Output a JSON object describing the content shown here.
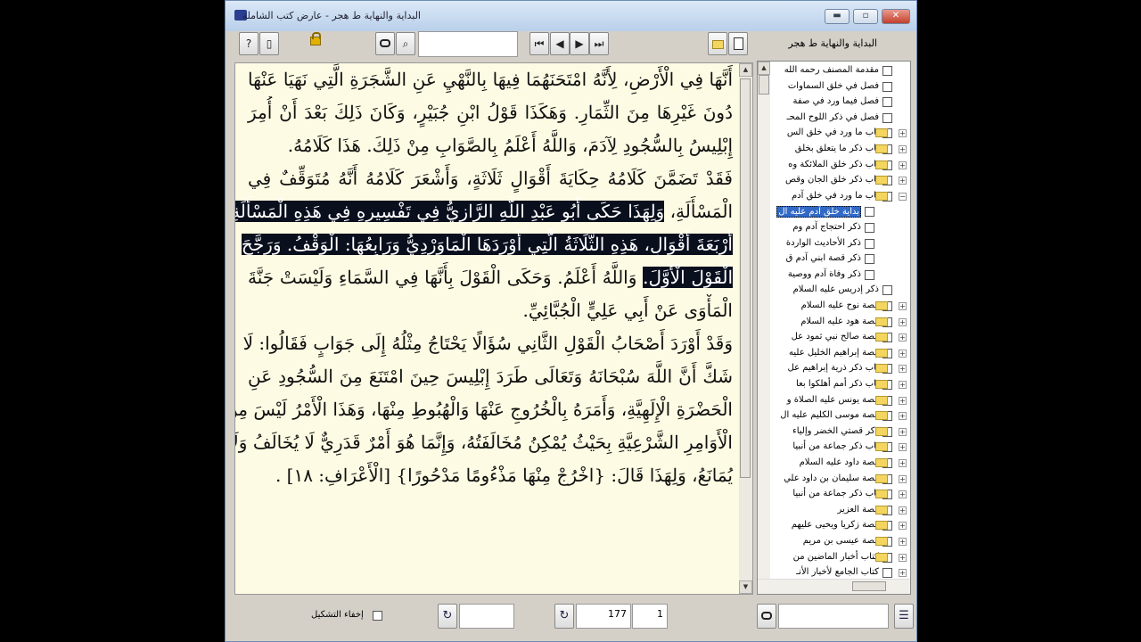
{
  "window": {
    "title": "البداية والنهاية ط هجر - عارض كتب الشاملة",
    "buttons": {
      "minimize": "▬",
      "maximize": "▫",
      "close": "✕"
    }
  },
  "toolbar": {
    "help_icon": "?",
    "page_icon": "▯",
    "search_icon": "⌕",
    "first_icon": "⏮",
    "prev_icon": "◀",
    "next_icon": "▶",
    "last_icon": "⏭",
    "search_value": "",
    "book_title": "البداية والنهاية ط هجر"
  },
  "content": {
    "lines": [
      {
        "pre": "أَنَّهَا فِي الْأَرْضِ، لِأَنَّهُ امْتَحَنَهُمَا فِيهَا بِالنَّهْيِ عَنِ الشَّجَرَةِ الَّتِي نَهَيَا عَنْهَا",
        "hl": "",
        "post": ""
      },
      {
        "pre": "دُونَ غَيْرِهَا مِنَ الثِّمَارِ. وَهَكَذَا قَوْلُ ابْنِ جُبَيْرٍ، وَكَانَ ذَلِكَ بَعْدَ أَنْ أُمِرَ",
        "hl": "",
        "post": ""
      },
      {
        "pre": "إِبْلِيسُ بِالسُّجُودِ لِآدَمَ، وَاللَّهُ أَعْلَمُ بِالصَّوَابِ مِنْ ذَلِكَ. هَذَا كَلَامُهُ.",
        "hl": "",
        "post": "",
        "last": true
      },
      {
        "pre": "فَقَدْ تَضَمَّنَ كَلَامُهُ حِكَايَةَ أَقْوَالٍ ثَلَاثَةٍ، وَأَشْعَرَ كَلَامُهُ أَنَّهُ مُتَوَقِّفٌ فِي",
        "hl": "",
        "post": ""
      },
      {
        "pre": "الْمَسْأَلَةِ، ",
        "hl": "وَلِهَذَا حَكَى أَبُو عَبْدِ اللَّهِ الرَّازِيُّ فِي تَفْسِيرِهِ فِي هَذِهِ الْمَسْأَلَةِ",
        "post": ""
      },
      {
        "pre": "",
        "hl": "أَرْبَعَةَ أَقْوَالٍ، هَذِهِ الثَّلَاثَةُ الَّتِي أَوْرَدَهَا الْمَاوَرْدِيُّ وَرَابِعُهَا: الْوَقْفُ. وَرَجَّحَ",
        "post": ""
      },
      {
        "pre": "",
        "hl": "الْقَوْلَ الْأَوَّلَ.",
        "post": " وَاللَّهُ أَعْلَمُ. وَحَكَى الْقَوْلَ بِأَنَّهَا فِي السَّمَاءِ وَلَيْسَتْ جَنَّةَ"
      },
      {
        "pre": "الْمَأْوَى عَنْ أَبِي عَلِيٍّ الْجُبَّائِيِّ.",
        "hl": "",
        "post": "",
        "last": true
      },
      {
        "pre": "وَقَدْ أَوْرَدَ أَصْحَابُ الْقَوْلِ الثَّانِي سُؤَالًا يَحْتَاجُ مِثْلُهُ إِلَى جَوَابٍ فَقَالُوا: لَا",
        "hl": "",
        "post": ""
      },
      {
        "pre": "شَكَّ أَنَّ اللَّهَ سُبْحَانَهُ وَتَعَالَى طَرَدَ إِبْلِيسَ حِينَ امْتَنَعَ مِنَ السُّجُودِ عَنِ",
        "hl": "",
        "post": ""
      },
      {
        "pre": "الْحَضْرَةِ الْإِلَهِيَّةِ، وَأَمَرَهُ بِالْخُرُوجِ عَنْهَا وَالْهُبُوطِ مِنْهَا، وَهَذَا الْأَمْرُ لَيْسَ مِنَ",
        "hl": "",
        "post": ""
      },
      {
        "pre": "الْأَوَامِرِ الشَّرْعِيَّةِ بِحَيْثُ يُمْكِنُ مُخَالَفَتُهُ، وَإِنَّمَا هُوَ أَمْرٌ قَدَرِيٌّ لَا يُخَالَفُ وَلَا",
        "hl": "",
        "post": ""
      },
      {
        "pre": "يُمَانَعُ، وَلِهَذَا قَالَ: {اخْرُجْ مِنْهَا مَذْءُومًا مَدْحُورًا} [الْأَعْرَافِ: ١٨] .",
        "hl": "",
        "post": "",
        "last": true
      }
    ]
  },
  "tree": {
    "items": [
      {
        "label": "مقدمة المصنف رحمه الله",
        "folder": false,
        "expander": ""
      },
      {
        "label": "فصل في خلق السماوات",
        "folder": false,
        "expander": ""
      },
      {
        "label": "فصل فيما ورد في صفة",
        "folder": false,
        "expander": ""
      },
      {
        "label": "فصل في ذكر اللوح المحـ",
        "folder": false,
        "expander": ""
      },
      {
        "label": "باب ما ورد في خلق الس",
        "folder": true,
        "expander": "+"
      },
      {
        "label": "باب ذكر ما يتعلق بخلق",
        "folder": true,
        "expander": "+"
      },
      {
        "label": "باب ذكر خلق الملائكة وه",
        "folder": true,
        "expander": "+"
      },
      {
        "label": "باب ذكر خلق الجان وقص",
        "folder": true,
        "expander": "+"
      },
      {
        "label": "باب ما ورد في خلق آدم",
        "folder": true,
        "expander": "−"
      },
      {
        "label": "بداية خلق آدم عليه ال",
        "folder": false,
        "expander": "",
        "child": true,
        "selected": true
      },
      {
        "label": "ذكر احتجاج آدم وم",
        "folder": false,
        "expander": "",
        "child": true
      },
      {
        "label": "ذكر الأحاديث الواردة",
        "folder": false,
        "expander": "",
        "child": true
      },
      {
        "label": "ذكر قصة ابني آدم ق",
        "folder": false,
        "expander": "",
        "child": true
      },
      {
        "label": "ذكر وفاة آدم ووصية",
        "folder": false,
        "expander": "",
        "child": true
      },
      {
        "label": "ذكر إدريس عليه السلام",
        "folder": false,
        "expander": ""
      },
      {
        "label": "قصة نوح عليه السلام",
        "folder": true,
        "expander": "+"
      },
      {
        "label": "قصة هود عليه السلام",
        "folder": true,
        "expander": "+"
      },
      {
        "label": "قصة صالح نبي ثمود عل",
        "folder": true,
        "expander": "+"
      },
      {
        "label": "قصة إبراهيم الخليل عليه",
        "folder": true,
        "expander": "+"
      },
      {
        "label": "باب ذكر ذرية إبراهيم عل",
        "folder": true,
        "expander": "+"
      },
      {
        "label": "باب ذكر أمم أهلكوا بعا",
        "folder": true,
        "expander": "+"
      },
      {
        "label": "قصة يونس عليه الصلاة و",
        "folder": true,
        "expander": "+"
      },
      {
        "label": "قصة موسى الكليم عليه ال",
        "folder": true,
        "expander": "+"
      },
      {
        "label": "ذكر قصتي الخضر وإلياء",
        "folder": true,
        "expander": "+"
      },
      {
        "label": "باب ذكر جماعة من أنبيا",
        "folder": true,
        "expander": "+"
      },
      {
        "label": "قصة داود عليه السلام",
        "folder": true,
        "expander": "+"
      },
      {
        "label": "قصة سليمان بن داود علي",
        "folder": true,
        "expander": "+"
      },
      {
        "label": "باب ذكر جماعة من أنبيا",
        "folder": true,
        "expander": "+"
      },
      {
        "label": "قصة العزير",
        "folder": true,
        "expander": "+"
      },
      {
        "label": "قصة زكريا ويحيى عليهم",
        "folder": true,
        "expander": "+"
      },
      {
        "label": "قصة عيسى بن مريم",
        "folder": true,
        "expander": "+"
      },
      {
        "label": "كتاب أخبار الماضين من",
        "folder": true,
        "expander": "+"
      },
      {
        "label": "كتاب الجامع لأخبار الأنـ",
        "folder": false,
        "expander": "+"
      }
    ]
  },
  "status": {
    "hide_diacritics_label": "إخفاء التشكيل",
    "refresh_icon": "↻",
    "input1_value": "",
    "part_value": "177",
    "page_value": "1",
    "find_icon": "⌕",
    "search2_value": "",
    "list_icon": "☰"
  }
}
